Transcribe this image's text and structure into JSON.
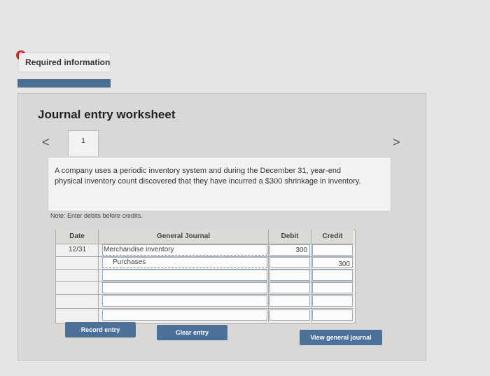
{
  "header": {
    "alert_glyph": "!",
    "required_title": "Required information"
  },
  "worksheet": {
    "title": "Journal entry worksheet",
    "prev_glyph": "<",
    "next_glyph": ">",
    "tab_label": "1",
    "prompt": "A company uses a periodic inventory system and during the December 31, year-end physical inventory count discovered that they have incurred a $300 shrinkage in inventory.",
    "note": "Note: Enter debits before credits."
  },
  "journal": {
    "columns": {
      "date": "Date",
      "general_journal": "General Journal",
      "debit": "Debit",
      "credit": "Credit"
    },
    "rows": [
      {
        "date": "12/31",
        "account": "Merchandise inventory",
        "debit": "300",
        "credit": ""
      },
      {
        "date": "",
        "account": "Purchases",
        "debit": "",
        "credit": "300"
      },
      {
        "date": "",
        "account": "",
        "debit": "",
        "credit": ""
      },
      {
        "date": "",
        "account": "",
        "debit": "",
        "credit": ""
      },
      {
        "date": "",
        "account": "",
        "debit": "",
        "credit": ""
      },
      {
        "date": "",
        "account": "",
        "debit": "",
        "credit": ""
      }
    ]
  },
  "buttons": {
    "record": "Record entry",
    "clear": "Clear entry",
    "view_journal": "View general journal"
  },
  "colors": {
    "button_blue": "#4b7199",
    "alert_red": "#c9302c"
  }
}
